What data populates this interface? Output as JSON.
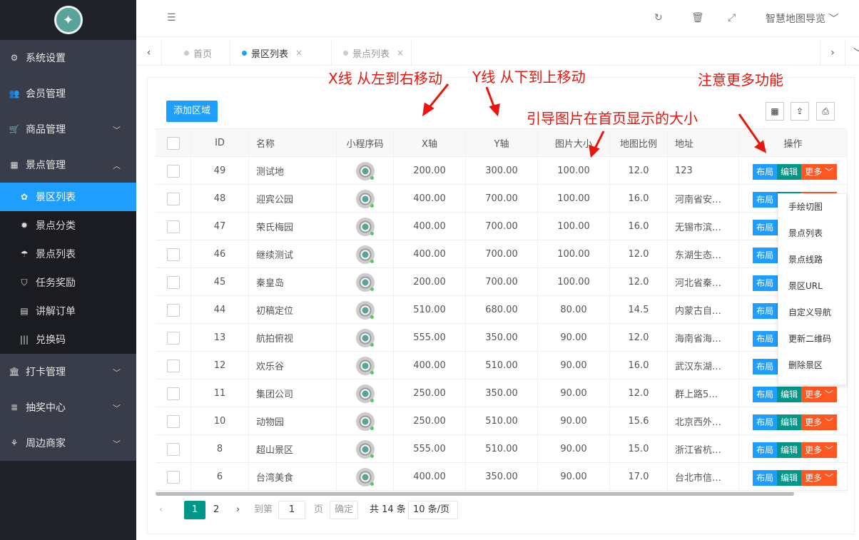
{
  "sidebar": {
    "items": [
      {
        "label": "系统设置",
        "icon": "gears-icon"
      },
      {
        "label": "会员管理",
        "icon": "users-icon"
      },
      {
        "label": "商品管理",
        "icon": "cart-icon"
      },
      {
        "label": "景点管理",
        "icon": "grid-icon"
      }
    ],
    "sub": [
      {
        "label": "景区列表",
        "icon": "cubes-icon"
      },
      {
        "label": "景点分类",
        "icon": "gear-icon"
      },
      {
        "label": "景点列表",
        "icon": "umbrella-icon"
      },
      {
        "label": "任务奖励",
        "icon": "shield-icon"
      },
      {
        "label": "讲解订单",
        "icon": "file-icon"
      },
      {
        "label": "兑换码",
        "icon": "barcode-icon"
      }
    ],
    "items2": [
      {
        "label": "打卡管理",
        "icon": "bank-icon"
      },
      {
        "label": "抽奖中心",
        "icon": "database-icon"
      },
      {
        "label": "周边商家",
        "icon": "sitemap-icon"
      }
    ]
  },
  "header": {
    "user": "智慧地图导览"
  },
  "tabs": [
    "首页",
    "景区列表",
    "景点列表"
  ],
  "toolbar": {
    "add": "添加区域"
  },
  "table": {
    "headers": [
      "ID",
      "名称",
      "小程序码",
      "X轴",
      "Y轴",
      "图片大小",
      "地图比例",
      "地址",
      "操作"
    ],
    "rows": [
      [
        "49",
        "测试地",
        "200.00",
        "300.00",
        "100.00",
        "12.0",
        "123"
      ],
      [
        "48",
        "迎宾公园",
        "400.00",
        "700.00",
        "100.00",
        "16.0",
        "河南省安…"
      ],
      [
        "47",
        "荣氏梅园",
        "400.00",
        "700.00",
        "100.00",
        "16.0",
        "无锡市滨…"
      ],
      [
        "46",
        "继续测试",
        "400.00",
        "700.00",
        "100.00",
        "12.0",
        "东湖生态…"
      ],
      [
        "45",
        "秦皇岛",
        "200.00",
        "700.00",
        "100.00",
        "12.0",
        "河北省秦…"
      ],
      [
        "44",
        "初稿定位",
        "510.00",
        "680.00",
        "80.00",
        "14.5",
        "内蒙古自…"
      ],
      [
        "13",
        "航拍俯视",
        "555.00",
        "350.00",
        "90.00",
        "12.0",
        "海南省海…"
      ],
      [
        "12",
        "欢乐谷",
        "400.00",
        "510.00",
        "90.00",
        "16.0",
        "武汉东湖…"
      ],
      [
        "11",
        "集团公司",
        "250.00",
        "350.00",
        "90.00",
        "12.0",
        "群上路5…"
      ],
      [
        "10",
        "动物园",
        "250.00",
        "510.00",
        "90.00",
        "15.6",
        "北京西外…"
      ],
      [
        "8",
        "超山景区",
        "555.00",
        "510.00",
        "90.00",
        "15.0",
        "浙江省杭…"
      ],
      [
        "6",
        "台湾美食",
        "400.00",
        "350.00",
        "90.00",
        "17.0",
        "台北市信…"
      ]
    ],
    "ops": {
      "layout": "布局",
      "edit": "编辑",
      "more": "更多"
    }
  },
  "dropdown": [
    "手绘切图",
    "景点列表",
    "景点线路",
    "景区URL",
    "自定义导航",
    "更新二维码",
    "删除景区"
  ],
  "pager": {
    "p1": "1",
    "p2": "2",
    "goto": "到第",
    "page_val": "1",
    "page_unit": "页",
    "confirm": "确定",
    "total": "共 14 条",
    "size": "10 条/页"
  },
  "annotations": {
    "x": "X线 从左到右移动",
    "y": "Y线 从下到上移动",
    "img": "引导图片在首页显示的大小",
    "more": "注意更多功能"
  }
}
